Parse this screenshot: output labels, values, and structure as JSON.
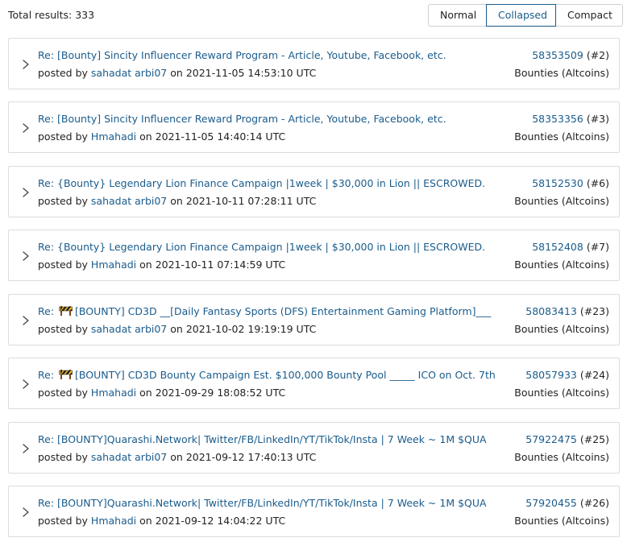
{
  "header": {
    "total_label": "Total results: 333"
  },
  "view_modes": [
    {
      "label": "Normal",
      "active": false
    },
    {
      "label": "Collapsed",
      "active": true
    },
    {
      "label": "Compact",
      "active": false
    }
  ],
  "results": [
    {
      "prefix": "Re: ",
      "title": "[Bounty] Sincity Influencer Reward Program - Article, Youtube, Facebook, etc.",
      "has_icon": false,
      "posted_by": "posted by",
      "author": "sahadat arbi07",
      "on": "on",
      "date": "2021-11-05 14:53:10 UTC",
      "msg_id": "58353509",
      "seq": "(#2)",
      "board": "Bounties (Altcoins)"
    },
    {
      "prefix": "Re: ",
      "title": "[Bounty] Sincity Influencer Reward Program - Article, Youtube, Facebook, etc.",
      "has_icon": false,
      "posted_by": "posted by",
      "author": "Hmahadi",
      "on": "on",
      "date": "2021-11-05 14:40:14 UTC",
      "msg_id": "58353356",
      "seq": "(#3)",
      "board": "Bounties (Altcoins)"
    },
    {
      "prefix": "Re: ",
      "title": "{Bounty} Legendary Lion Finance Campaign |1week | $30,000 in Lion || ESCROWED.",
      "has_icon": false,
      "posted_by": "posted by",
      "author": "sahadat arbi07",
      "on": "on",
      "date": "2021-10-11 07:28:11 UTC",
      "msg_id": "58152530",
      "seq": "(#6)",
      "board": "Bounties (Altcoins)"
    },
    {
      "prefix": "Re: ",
      "title": "{Bounty} Legendary Lion Finance Campaign |1week | $30,000 in Lion || ESCROWED.",
      "has_icon": false,
      "posted_by": "posted by",
      "author": "Hmahadi",
      "on": "on",
      "date": "2021-10-11 07:14:59 UTC",
      "msg_id": "58152408",
      "seq": "(#7)",
      "board": "Bounties (Altcoins)"
    },
    {
      "prefix": "Re: ",
      "title": "[BOUNTY] CD3D __[Daily Fantasy Sports (DFS) Entertainment Gaming Platform]___",
      "has_icon": true,
      "posted_by": "posted by",
      "author": "sahadat arbi07",
      "on": "on",
      "date": "2021-10-02 19:19:19 UTC",
      "msg_id": "58083413",
      "seq": "(#23)",
      "board": "Bounties (Altcoins)"
    },
    {
      "prefix": "Re: ",
      "title": "[BOUNTY] CD3D Bounty Campaign Est. $100,000 Bounty Pool _____ ICO on Oct. 7th",
      "has_icon": true,
      "posted_by": "posted by",
      "author": "Hmahadi",
      "on": "on",
      "date": "2021-09-29 18:08:52 UTC",
      "msg_id": "58057933",
      "seq": "(#24)",
      "board": "Bounties (Altcoins)"
    },
    {
      "prefix": "Re: ",
      "title": "[BOUNTY]Quarashi.Network| Twitter/FB/LinkedIn/YT/TikTok/Insta | 7 Week ~ 1M $QUA",
      "has_icon": false,
      "posted_by": "posted by",
      "author": "sahadat arbi07",
      "on": "on",
      "date": "2021-09-12 17:40:13 UTC",
      "msg_id": "57922475",
      "seq": "(#25)",
      "board": "Bounties (Altcoins)"
    },
    {
      "prefix": "Re: ",
      "title": "[BOUNTY]Quarashi.Network| Twitter/FB/LinkedIn/YT/TikTok/Insta | 7 Week ~ 1M $QUA",
      "has_icon": false,
      "posted_by": "posted by",
      "author": "Hmahadi",
      "on": "on",
      "date": "2021-09-12 14:04:22 UTC",
      "msg_id": "57920455",
      "seq": "(#26)",
      "board": "Bounties (Altcoins)"
    }
  ],
  "icons": {
    "expand": "chevron-right-icon",
    "title_badge": "construction-barrier-icon"
  },
  "colors": {
    "link": "#1a5c8c",
    "border": "#dcdcdc"
  }
}
